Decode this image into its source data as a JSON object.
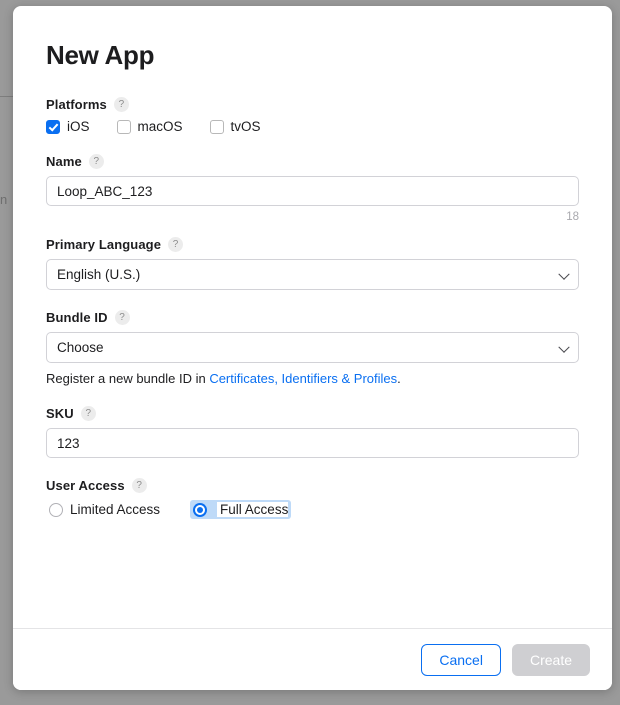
{
  "background": {
    "scrim_color": "#9a9a9a",
    "edge_glyph": "n"
  },
  "modal": {
    "title": "New App",
    "fields": {
      "platforms": {
        "label": "Platforms",
        "help": "?",
        "options": [
          {
            "label": "iOS",
            "checked": true
          },
          {
            "label": "macOS",
            "checked": false
          },
          {
            "label": "tvOS",
            "checked": false
          }
        ]
      },
      "name": {
        "label": "Name",
        "help": "?",
        "value": "Loop_ABC_123",
        "placeholder": "",
        "counter": "18"
      },
      "primary_language": {
        "label": "Primary Language",
        "help": "?",
        "value": "English (U.S.)",
        "icon": "chevron-down-icon"
      },
      "bundle_id": {
        "label": "Bundle ID",
        "help": "?",
        "value": "Choose",
        "icon": "chevron-down-icon",
        "hint_prefix": "Register a new bundle ID in ",
        "hint_link": "Certificates, Identifiers & Profiles",
        "hint_suffix": ".",
        "link_color": "#0a6ff1"
      },
      "sku": {
        "label": "SKU",
        "help": "?",
        "value": "123",
        "placeholder": ""
      },
      "user_access": {
        "label": "User Access",
        "help": "?",
        "options": [
          {
            "label": "Limited Access",
            "selected": false,
            "focused": false
          },
          {
            "label": "Full Access",
            "selected": true,
            "focused": true
          }
        ]
      }
    },
    "footer": {
      "cancel_label": "Cancel",
      "create_label": "Create",
      "create_disabled": true
    }
  },
  "colors": {
    "accent": "#0a6ff1",
    "disabled": "#cfcfd2",
    "text": "#1d1d1f",
    "focus_ring": "#bedaf8"
  }
}
